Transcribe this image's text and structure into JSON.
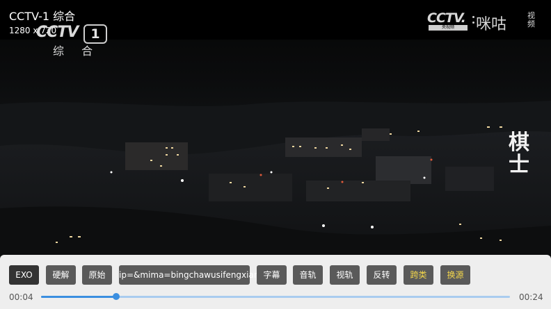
{
  "channel": {
    "title": "CCTV-1 综合",
    "resolution": "1280 x 720"
  },
  "watermark_left": {
    "brand": "CCTV",
    "number": "1",
    "name": "综 合"
  },
  "watermark_right": {
    "brand": "CCTV.",
    "tagline": "央视频",
    "partner": "咪咕",
    "partner_suffix": "视频"
  },
  "show_title": "棋士",
  "controls": {
    "buttons": [
      {
        "label": "EXO",
        "style": "dark"
      },
      {
        "label": "硬解",
        "style": "normal"
      },
      {
        "label": "原始",
        "style": "normal"
      },
      {
        "label": "ip=&mima=bingchawusifengxian",
        "style": "normal"
      },
      {
        "label": "字幕",
        "style": "normal"
      },
      {
        "label": "音轨",
        "style": "normal"
      },
      {
        "label": "视轨",
        "style": "normal"
      },
      {
        "label": "反转",
        "style": "normal"
      },
      {
        "label": "跨类",
        "style": "yellow"
      },
      {
        "label": "换源",
        "style": "yellow"
      }
    ],
    "elapsed": "00:04",
    "duration": "00:24",
    "progress": 0.16
  },
  "colors": {
    "accent": "#3b8fe0",
    "highlight_text": "#f3d64b",
    "panel": "#eeeeee"
  }
}
